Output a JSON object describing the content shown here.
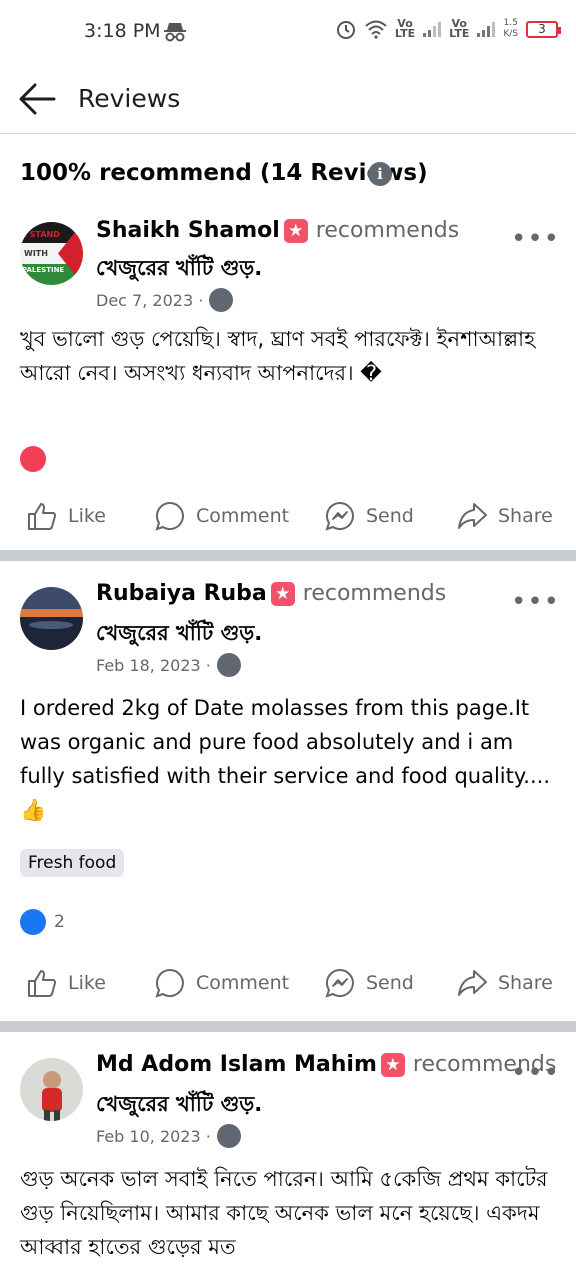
{
  "status": {
    "time": "3:18 PM",
    "speed_top": "1.5",
    "speed_bottom": "K/S",
    "battery": "3",
    "vo1": "Vo",
    "lte1": "LTE",
    "vo2": "Vo",
    "lte2": "LTE"
  },
  "appbar": {
    "title": "Reviews"
  },
  "summary": {
    "text": "100% recommend (14 Reviews)",
    "info_glyph": "i"
  },
  "actions": {
    "like": "Like",
    "comment": "Comment",
    "send": "Send",
    "share": "Share"
  },
  "reviews": [
    {
      "name": "Shaikh Shamol",
      "verb": "recommends",
      "page": "খেজুরের খাঁটি গুড়.",
      "date": "Dec 7, 2023 ·",
      "text": "খুব ভালো গুড় পেয়েছি। স্বাদ, ঘ্রাণ সবই পারফেক্ট। ইনশাআল্লাহ আরো নেব। অসংখ্য ধন্যবাদ আপনাদের। �",
      "avatar_text": [
        "I STAND",
        "WITH",
        "PALESTINE"
      ]
    },
    {
      "name": "Rubaiya Ruba",
      "verb": "recommends",
      "page": "খেজুরের খাঁটি গুড়.",
      "date": "Feb 18, 2023 ·",
      "text": "I ordered 2kg of Date molasses from this page.It was organic and pure food absolutely and i am fully satisfied with their service and food quality....👍",
      "tag": "Fresh food",
      "reaction_count": "2"
    },
    {
      "name": "Md Adom Islam Mahim",
      "verb": "recommends",
      "page": "খেজুরের খাঁটি গুড়.",
      "date": "Feb 10, 2023 ·",
      "text": "গুড় অনেক ভাল সবাই নিতে পারেন। আমি ৫কেজি প্রথম কাটের গুড় নিয়েছিলাম। আমার কাছে অনেক ভাল মনে হয়েছে। একদম আব্বার হাতের গুড়ের মত"
    }
  ],
  "colors": {
    "accent": "#1877f2",
    "muted": "#65676b",
    "divider": "#c9ccd1",
    "star": "#f25268",
    "heart": "#f33e58"
  }
}
